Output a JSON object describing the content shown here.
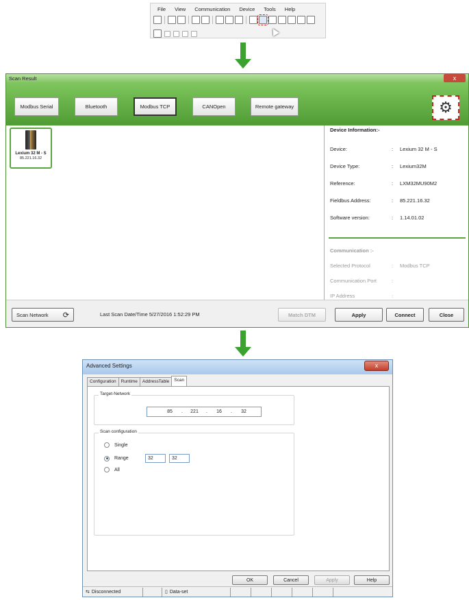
{
  "menu": {
    "items": [
      "File",
      "View",
      "Communication",
      "Device",
      "Tools",
      "Help"
    ]
  },
  "scan_result": {
    "title": "Scan Result",
    "close_glyph": "x",
    "protocols": [
      "Modbus Serial",
      "Bluetooth",
      "Modbus TCP",
      "CANOpen",
      "Remote gateway"
    ],
    "active_protocol": "Modbus TCP",
    "device_card": {
      "name": "Lexium 32 M - S",
      "ip": "85.221.16.32"
    },
    "device_info": {
      "header": "Device Information:-",
      "rows": [
        {
          "key": "Device:",
          "value": "Lexium 32 M - S"
        },
        {
          "key": "Device Type:",
          "value": "Lexium32M"
        },
        {
          "key": "Reference:",
          "value": "LXM32MU90M2"
        },
        {
          "key": "Fieldbus Address:",
          "value": "85.221.16.32"
        },
        {
          "key": "Software version:",
          "value": "1.14.01.02"
        }
      ]
    },
    "communication": {
      "header": "Communication :-",
      "rows": [
        {
          "key": "Selected Protocol",
          "value": "Modbus TCP"
        },
        {
          "key": "Communication Port",
          "value": ""
        },
        {
          "key": "IP Address",
          "value": ""
        }
      ]
    },
    "footer": {
      "scan_network": "Scan Network",
      "last_scan": "Last Scan Date/Time 5/27/2016 1:52:29 PM",
      "match_dtm": "Match DTM",
      "apply": "Apply",
      "connect": "Connect",
      "close": "Close"
    }
  },
  "advanced": {
    "title": "Advanced Settings",
    "close_glyph": "x",
    "tabs": [
      "Configuration",
      "Runtime",
      "AddressTable",
      "Scan"
    ],
    "active_tab": "Scan",
    "target_network": {
      "legend": "Target-Network",
      "octets": [
        "85",
        "221",
        "16",
        "32"
      ]
    },
    "scan_config": {
      "legend": "Scan configuration",
      "options": [
        "Single",
        "Range",
        "All"
      ],
      "selected": "Range",
      "range_from": "32",
      "range_to": "32"
    },
    "buttons": {
      "ok": "OK",
      "cancel": "Cancel",
      "apply": "Apply",
      "help": "Help"
    },
    "status": {
      "connection": "Disconnected",
      "dataset": "Data-set"
    }
  }
}
